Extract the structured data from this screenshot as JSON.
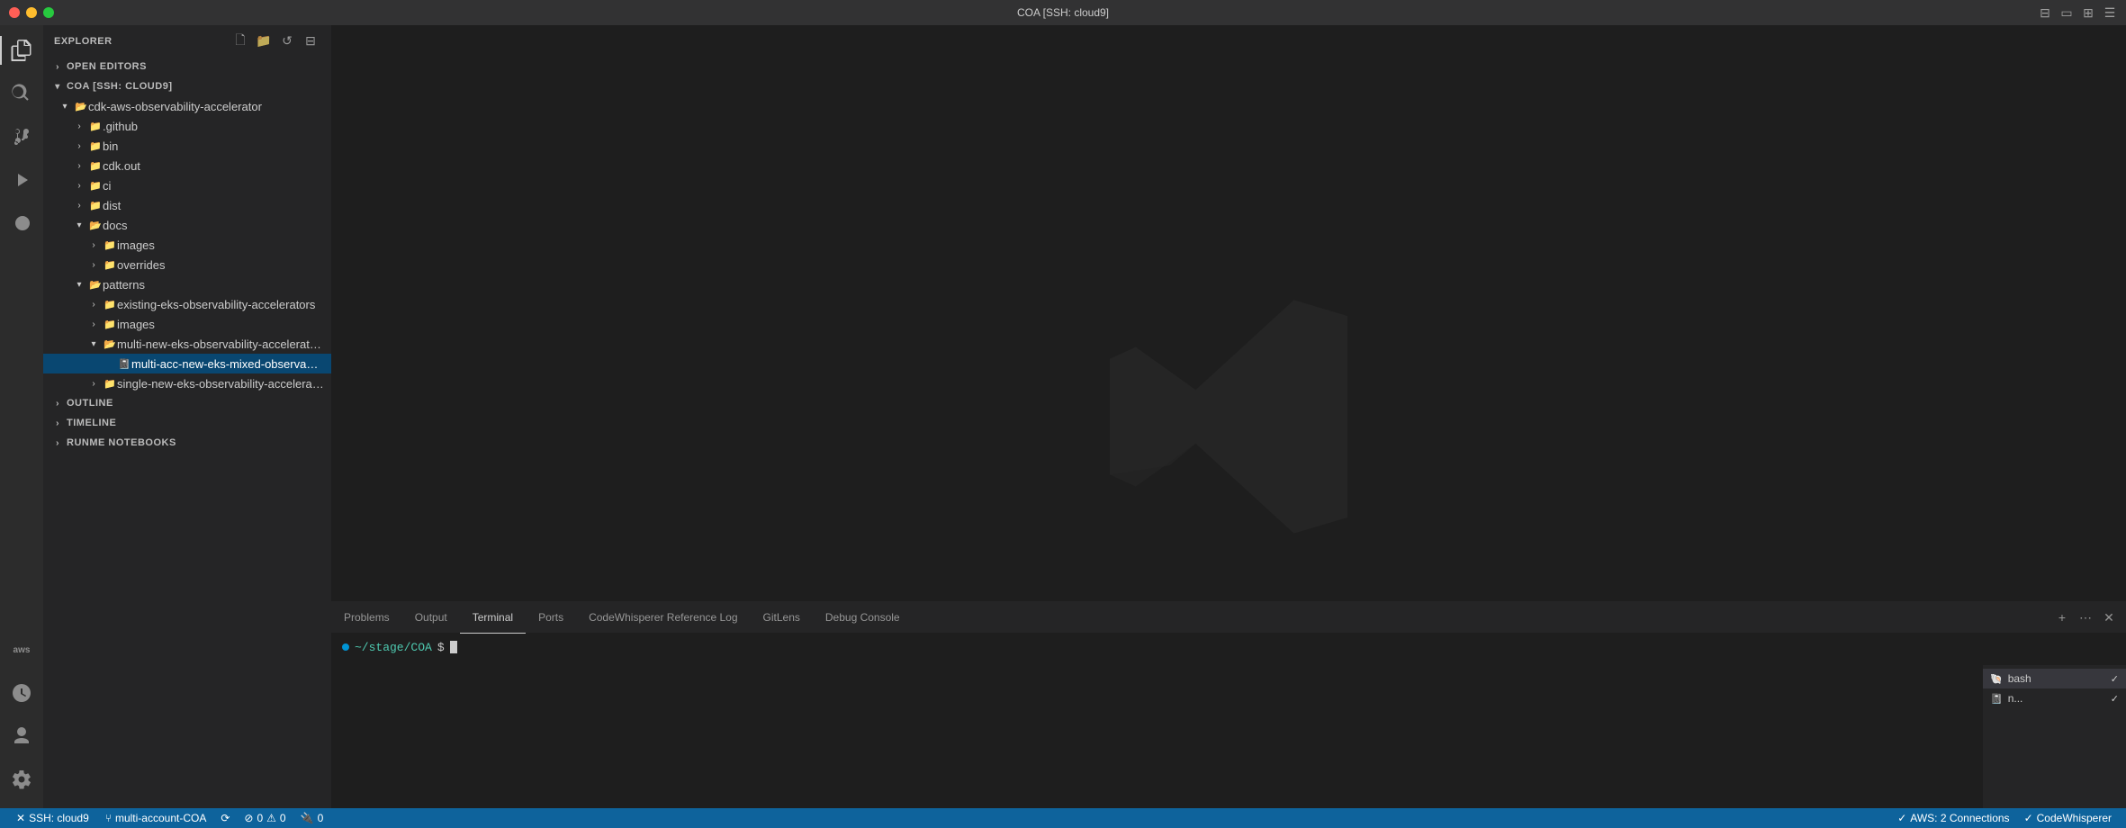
{
  "titleBar": {
    "title": "COA [SSH: cloud9]",
    "buttons": {
      "close": "close",
      "minimize": "minimize",
      "maximize": "maximize"
    }
  },
  "activityBar": {
    "items": [
      {
        "id": "explorer",
        "icon": "📄",
        "label": "Explorer",
        "active": true
      },
      {
        "id": "search",
        "icon": "🔍",
        "label": "Search",
        "active": false
      },
      {
        "id": "source-control",
        "icon": "⑂",
        "label": "Source Control",
        "active": false
      },
      {
        "id": "run-debug",
        "icon": "▶",
        "label": "Run and Debug",
        "active": false
      },
      {
        "id": "extensions",
        "icon": "⊞",
        "label": "Extensions",
        "active": false
      }
    ],
    "bottomItems": [
      {
        "id": "aws",
        "label": "AWS",
        "active": false
      },
      {
        "id": "runme",
        "icon": "📓",
        "label": "Runme",
        "active": false
      },
      {
        "id": "account",
        "icon": "👤",
        "label": "Account",
        "active": false
      },
      {
        "id": "settings",
        "icon": "⚙",
        "label": "Settings",
        "active": false
      }
    ]
  },
  "sidebar": {
    "title": "Explorer",
    "moreLabel": "...",
    "sections": {
      "openEditors": {
        "label": "Open Editors",
        "expanded": false
      },
      "coa": {
        "label": "COA [SSH: CLOUD9]",
        "expanded": true
      }
    },
    "tree": [
      {
        "id": "cdk-aws",
        "label": "cdk-aws-observability-accelerator",
        "type": "folder-open",
        "depth": 1,
        "expanded": true
      },
      {
        "id": "github",
        "label": ".github",
        "type": "folder",
        "depth": 2,
        "expanded": false
      },
      {
        "id": "bin",
        "label": "bin",
        "type": "folder",
        "depth": 2,
        "expanded": false
      },
      {
        "id": "cdk-out",
        "label": "cdk.out",
        "type": "folder",
        "depth": 2,
        "expanded": false
      },
      {
        "id": "ci",
        "label": "ci",
        "type": "folder",
        "depth": 2,
        "expanded": false
      },
      {
        "id": "dist",
        "label": "dist",
        "type": "folder",
        "depth": 2,
        "expanded": false
      },
      {
        "id": "docs",
        "label": "docs",
        "type": "folder-open",
        "depth": 2,
        "expanded": true
      },
      {
        "id": "images",
        "label": "images",
        "type": "folder",
        "depth": 3,
        "expanded": false
      },
      {
        "id": "overrides",
        "label": "overrides",
        "type": "folder",
        "depth": 3,
        "expanded": false
      },
      {
        "id": "patterns",
        "label": "patterns",
        "type": "folder-open",
        "depth": 2,
        "expanded": true
      },
      {
        "id": "existing-eks",
        "label": "existing-eks-observability-accelerators",
        "type": "folder",
        "depth": 3,
        "expanded": false
      },
      {
        "id": "images2",
        "label": "images",
        "type": "folder",
        "depth": 3,
        "expanded": false
      },
      {
        "id": "multi-new-eks",
        "label": "multi-new-eks-observability-accelerators",
        "type": "folder-open",
        "depth": 3,
        "expanded": true
      },
      {
        "id": "multi-acc-file",
        "label": "multi-acc-new-eks-mixed-observability.md",
        "type": "notebook",
        "depth": 4,
        "expanded": false,
        "selected": true
      },
      {
        "id": "single-new-eks",
        "label": "single-new-eks-observability-accelerators",
        "type": "folder",
        "depth": 3,
        "expanded": false
      }
    ],
    "outline": {
      "label": "Outline",
      "expanded": false
    },
    "timeline": {
      "label": "Timeline",
      "expanded": false
    },
    "runmeNotebooks": {
      "label": "Runme Notebooks",
      "expanded": false
    }
  },
  "panel": {
    "tabs": [
      {
        "id": "problems",
        "label": "Problems",
        "active": false
      },
      {
        "id": "output",
        "label": "Output",
        "active": false
      },
      {
        "id": "terminal",
        "label": "Terminal",
        "active": true
      },
      {
        "id": "ports",
        "label": "Ports",
        "active": false
      },
      {
        "id": "codewhisperer",
        "label": "CodeWhisperer Reference Log",
        "active": false
      },
      {
        "id": "gitlens",
        "label": "GitLens",
        "active": false
      },
      {
        "id": "debug-console",
        "label": "Debug Console",
        "active": false
      }
    ],
    "terminal": {
      "path": "~/stage/COA",
      "prompt": "$",
      "instances": [
        {
          "id": "bash",
          "label": "bash",
          "icon": "🐚",
          "active": true,
          "check": true
        },
        {
          "id": "n",
          "label": "n...",
          "icon": "📓",
          "active": false,
          "check": true
        }
      ]
    }
  },
  "statusBar": {
    "items": [
      {
        "id": "ssh",
        "icon": "✕",
        "label": "SSH: cloud9",
        "type": "remote"
      },
      {
        "id": "branch",
        "icon": "",
        "label": "multi-account-COA",
        "type": "branch"
      },
      {
        "id": "sync",
        "icon": "⟳",
        "label": "",
        "type": "sync"
      },
      {
        "id": "errors",
        "icon": "⊘",
        "label": "0",
        "type": "errors"
      },
      {
        "id": "warnings",
        "icon": "⚠",
        "label": "0",
        "type": "warnings"
      },
      {
        "id": "ports",
        "icon": "🔌",
        "label": "0",
        "type": "ports"
      },
      {
        "id": "aws",
        "icon": "✓",
        "label": "AWS: 2 Connections",
        "type": "aws"
      },
      {
        "id": "codewhisperer",
        "icon": "✓",
        "label": "CodeWhisperer",
        "type": "codewhisperer"
      }
    ]
  }
}
